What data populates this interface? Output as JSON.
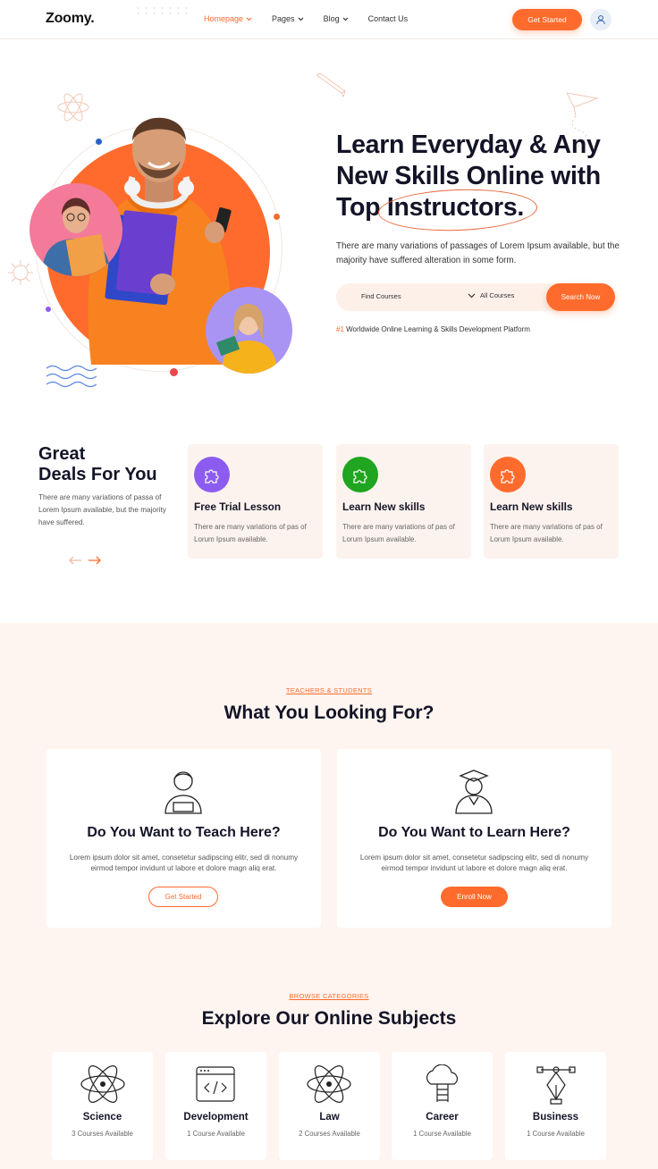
{
  "header": {
    "logo": "Zoomy.",
    "nav": [
      {
        "label": "Homepage",
        "has_dropdown": true,
        "active": true
      },
      {
        "label": "Pages",
        "has_dropdown": true,
        "active": false
      },
      {
        "label": "Blog",
        "has_dropdown": true,
        "active": false
      },
      {
        "label": "Contact Us",
        "has_dropdown": false,
        "active": false
      }
    ],
    "cta_label": "Get Started",
    "user_icon": "user-icon"
  },
  "hero": {
    "title_line1": "Learn Everyday & Any",
    "title_line2": "New Skills Online with",
    "title_line3_prefix": "Top ",
    "title_line3_highlight": "Instructors.",
    "description": "There are many variations of passages of Lorem Ipsum available, but the majority have suffered alteration in some form.",
    "search": {
      "placeholder": "Find Courses",
      "category": "All Courses",
      "button": "Search Now"
    },
    "platform_rank": "#1",
    "platform_text": " Worldwide Online Learning & Skills Development Platform"
  },
  "deals": {
    "title_line1": "Great",
    "title_line2": "Deals For You",
    "description": "There are many variations of passa of Lorem Ipsum available, but the majority have suffered.",
    "cards": [
      {
        "title": "Free Trial Lesson",
        "description": "There are many variations of pas of Lorum Ipsum available.",
        "icon": "puzzle-icon",
        "color": "#8c5cf0"
      },
      {
        "title": "Learn New skills",
        "description": "There are many variations of pas of Lorum Ipsum available.",
        "icon": "puzzle-icon",
        "color": "#1fa51f"
      },
      {
        "title": "Learn New skills",
        "description": "There are many variations of pas of Lorum Ipsum available.",
        "icon": "puzzle-icon",
        "color": "#ff6b2c"
      }
    ]
  },
  "looking": {
    "eyebrow": "TEACHERS & STUDENTS",
    "title": "What You Looking For?",
    "cards": [
      {
        "title": "Do You Want to Teach Here?",
        "description_line1": "Lorem ipsum dolor sit amet, consetetur sadipscing elitr, sed di nonumy",
        "description_line2": "eirmod tempor invidunt ut labore et dolore magn aliq erat.",
        "button": "Get Started",
        "icon": "teacher-icon"
      },
      {
        "title": "Do You Want to Learn Here?",
        "description_line1": "Lorem ipsum dolor sit amet, consetetur sadipscing elitr, sed di nonumy",
        "description_line2": "eirmod tempor invidunt ut labore et dolore magn aliq erat.",
        "button": "Enroll Now",
        "icon": "graduate-icon"
      }
    ]
  },
  "subjects": {
    "eyebrow": "BROWSE CATEGORIES",
    "title": "Explore Our Online Subjects",
    "items": [
      {
        "name": "Science",
        "count": "3 Courses Available",
        "icon": "atom-icon"
      },
      {
        "name": "Development",
        "count": "1 Course Available",
        "icon": "code-window-icon"
      },
      {
        "name": "Law",
        "count": "2 Courses Available",
        "icon": "atom-icon"
      },
      {
        "name": "Career",
        "count": "1 Course Available",
        "icon": "cloud-ladder-icon"
      },
      {
        "name": "Business",
        "count": "1 Course Available",
        "icon": "pen-tool-icon"
      }
    ]
  },
  "colors": {
    "accent": "#ff6b2c",
    "section_bg": "#fff5f0",
    "card_bg": "#fdf3ee",
    "heading": "#141428"
  }
}
